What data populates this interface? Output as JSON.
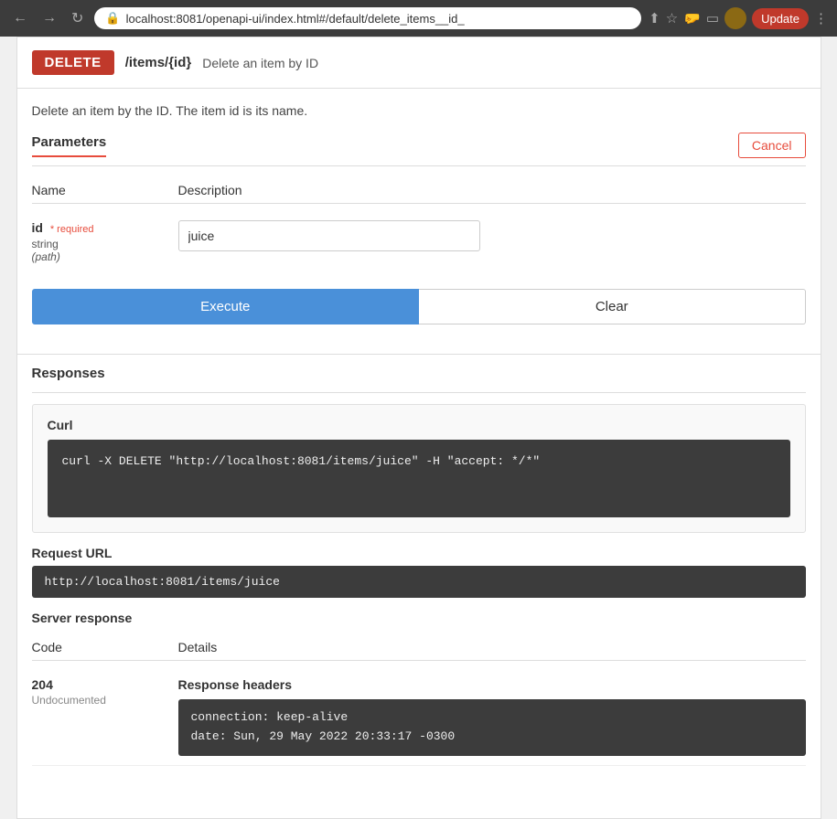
{
  "browser": {
    "url": "localhost:8081/openapi-ui/index.html#/default/delete_items__id_",
    "update_label": "Update"
  },
  "endpoint": {
    "method": "DELETE",
    "path": "/items/{id}",
    "description_inline": "Delete an item by ID",
    "description_full": "Delete an item by the ID. The item id is its name.",
    "parameters_title": "Parameters",
    "cancel_label": "Cancel",
    "name_col_header": "Name",
    "description_col_header": "Description"
  },
  "params": [
    {
      "name": "id",
      "required_label": "* required",
      "type": "string",
      "location": "(path)",
      "value": "juice",
      "placeholder": ""
    }
  ],
  "actions": {
    "execute_label": "Execute",
    "clear_label": "Clear"
  },
  "responses": {
    "title": "Responses",
    "curl_label": "Curl",
    "curl_command": "curl -X DELETE \"http://localhost:8081/items/juice\" -H \"accept: */*\"",
    "request_url_label": "Request URL",
    "request_url": "http://localhost:8081/items/juice",
    "server_response_title": "Server response",
    "code_col": "Code",
    "details_col": "Details",
    "response_code": "204",
    "response_note": "Undocumented",
    "response_headers_label": "Response headers",
    "response_headers": "connection: keep-alive\ndate: Sun, 29 May 2022 20:33:17 -0300"
  }
}
